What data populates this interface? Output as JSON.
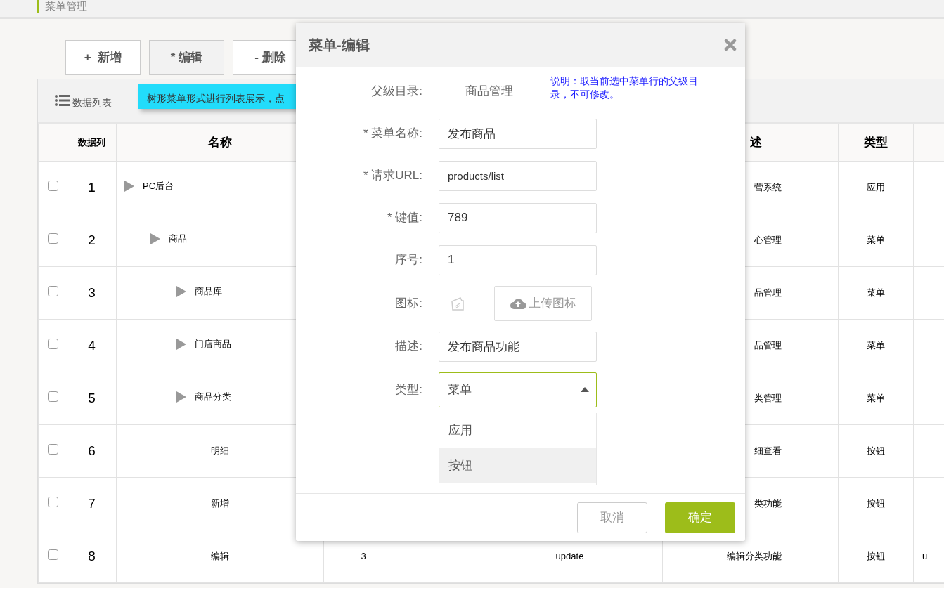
{
  "header": {
    "title": "菜单管理"
  },
  "toolbar": {
    "buttons": [
      {
        "label": "+  新增",
        "pressed": false
      },
      {
        "label": "* 编辑",
        "pressed": true
      },
      {
        "label": "- 删除",
        "pressed": false
      }
    ]
  },
  "panel": {
    "title": "数据列表",
    "tooltip": "树形菜单形式进行列表展示，点"
  },
  "table": {
    "columns": [
      {
        "kind": "check"
      },
      {
        "label": "数据列"
      },
      {
        "label": "名称"
      },
      {},
      {},
      {},
      {
        "label": "述",
        "kind": "desc"
      },
      {
        "label": "类型"
      },
      {}
    ],
    "rows": [
      {
        "checked": false,
        "index": "1",
        "name": "PC后台",
        "kind": "branch",
        "description": "营系统",
        "type": "应用",
        "children": [
          {
            "checked": false,
            "index": "2",
            "name": "商品",
            "kind": "branch",
            "description": "心管理",
            "type": "菜单",
            "children": [
              {
                "checked": false,
                "index": "3",
                "name": "商品库",
                "kind": "branch",
                "description": "品管理",
                "type": "菜单"
              },
              {
                "checked": false,
                "index": "4",
                "name": "门店商品",
                "kind": "branch",
                "description": "品管理",
                "type": "菜单"
              },
              {
                "checked": false,
                "index": "5",
                "name": "商品分类",
                "kind": "branch",
                "description": "类管理",
                "type": "菜单",
                "children": [
                  {
                    "checked": false,
                    "index": "6",
                    "name": "明细",
                    "kind": "leaf",
                    "description": "细查看",
                    "type": "按钮"
                  },
                  {
                    "checked": false,
                    "index": "7",
                    "name": "新增",
                    "kind": "leaf",
                    "description": "类功能",
                    "type": "按钮"
                  },
                  {
                    "checked": false,
                    "index": "8",
                    "name": "编辑",
                    "kind": "leaf",
                    "column_4": "3",
                    "column_6": "update",
                    "description": "编辑分类功能",
                    "type": "按钮",
                    "column_9": "u"
                  }
                ]
              }
            ]
          }
        ]
      }
    ]
  },
  "dialog": {
    "title": "菜单-编辑",
    "note": "说明：取当前选中菜单行的父级目录，不可修改。",
    "fields": [
      {
        "kind": "text",
        "label": "父级目录:",
        "value": "商品管理"
      },
      {
        "kind": "input",
        "label": "* 菜单名称:",
        "value": "发布商品"
      },
      {
        "kind": "input",
        "label": "* 请求URL:",
        "value": "products/list"
      },
      {
        "kind": "input",
        "label": "* 键值:",
        "value": "789"
      },
      {
        "kind": "input",
        "label": "序号:",
        "value": "1"
      },
      {
        "kind": "upload",
        "label": "图标:",
        "button": "上传图标"
      },
      {
        "kind": "input",
        "label": "描述:",
        "value": "发布商品功能"
      },
      {
        "kind": "select",
        "label": "类型:",
        "value": "菜单",
        "expanded": true,
        "options": [
          {
            "label": "应用",
            "highlighted": false
          },
          {
            "label": "按钮",
            "highlighted": true
          }
        ]
      }
    ],
    "buttons": [
      {
        "label": "取消",
        "kind": "secondary"
      },
      {
        "label": "确定",
        "kind": "primary"
      }
    ]
  }
}
